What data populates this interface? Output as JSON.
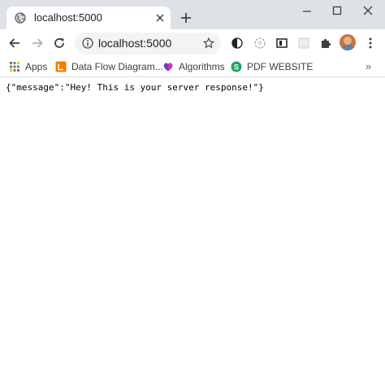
{
  "tab": {
    "title": "localhost:5000",
    "favicon": "globe-icon"
  },
  "window_controls": [
    "minimize-icon",
    "maximize-icon",
    "close-icon"
  ],
  "toolbar": {
    "url": "localhost:5000",
    "extensions": [
      "dark-mode-icon",
      "extension-spinner-icon",
      "reader-icon",
      "blank-extension-icon",
      "puzzle-icon",
      "profile-avatar"
    ]
  },
  "bookmarks": {
    "items": [
      {
        "label": "Apps",
        "icon": "apps-grid-icon"
      },
      {
        "label": "Data Flow Diagram...",
        "icon": "dfd-icon"
      },
      {
        "label": "Algorithms",
        "icon": "algorithms-icon"
      },
      {
        "label": "PDF WEBSITE",
        "icon": "pdf-site-icon"
      }
    ],
    "overflow": "»"
  },
  "page": {
    "body_text": "{\"message\":\"Hey! This is your server response!\"}"
  },
  "colors": {
    "tabstrip": "#dee1e6",
    "omnibox": "#f1f3f4",
    "icon": "#5f6368"
  }
}
